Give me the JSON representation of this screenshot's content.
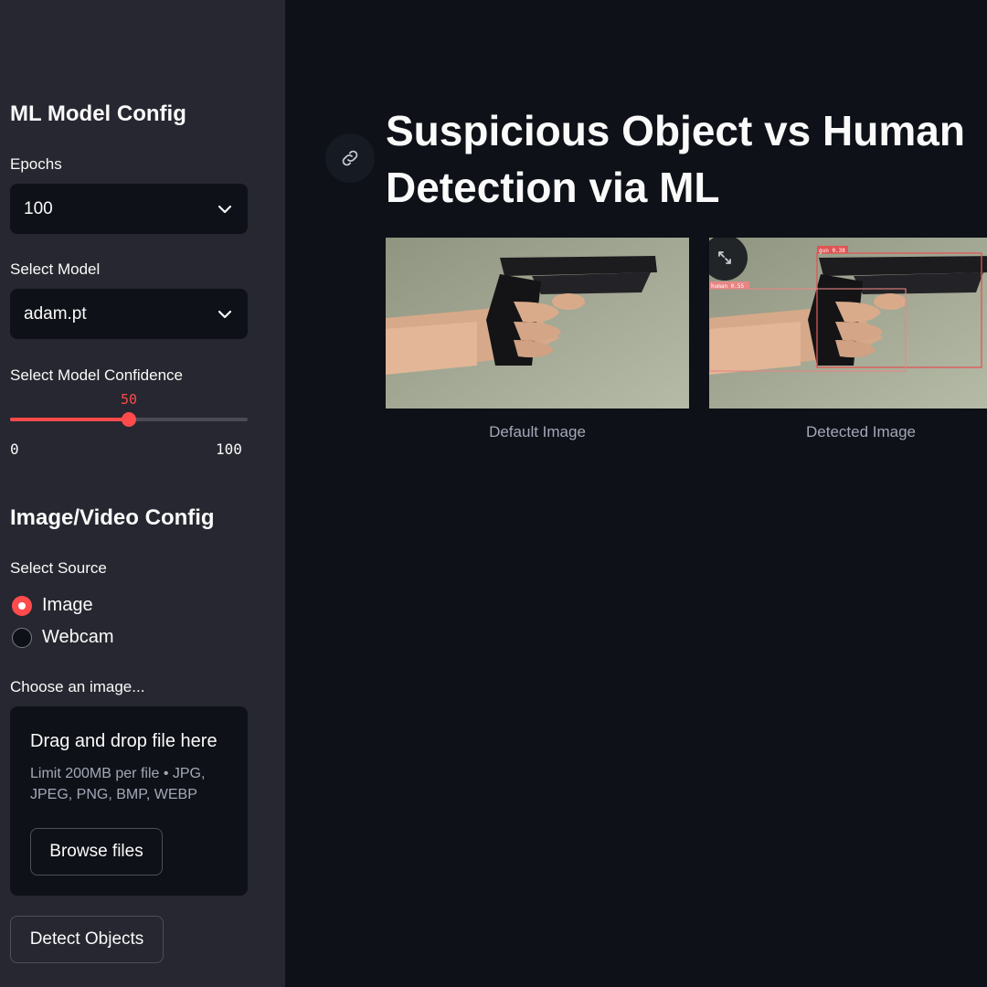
{
  "sidebar": {
    "model_heading": "ML Model Config",
    "epochs_label": "Epochs",
    "epochs_value": "100",
    "model_label": "Select Model",
    "model_value": "adam.pt",
    "confidence_label": "Select Model Confidence",
    "confidence": {
      "value": "50",
      "min": "0",
      "max": "100",
      "fraction": 0.5
    },
    "source_heading": "Image/Video Config",
    "source_label": "Select Source",
    "source_options": [
      {
        "label": "Image",
        "selected": true
      },
      {
        "label": "Webcam",
        "selected": false
      }
    ],
    "choose_label": "Choose an image...",
    "uploader": {
      "title": "Drag and drop file here",
      "limit": "Limit 200MB per file • JPG, JPEG, PNG, BMP, WEBP",
      "browse_label": "Browse files"
    },
    "detect_label": "Detect Objects"
  },
  "main": {
    "title_line1": "Suspicious Object vs Human",
    "title_line2": "Detection via ML",
    "default_caption": "Default Image",
    "detected_caption": "Detected Image",
    "detections": [
      {
        "label": "gun 0.38"
      },
      {
        "label": "human 0.55"
      }
    ]
  },
  "colors": {
    "accent": "#ff4b4b",
    "sidebar_bg": "#262730",
    "main_bg": "#0e1117",
    "box": "#e05555"
  }
}
